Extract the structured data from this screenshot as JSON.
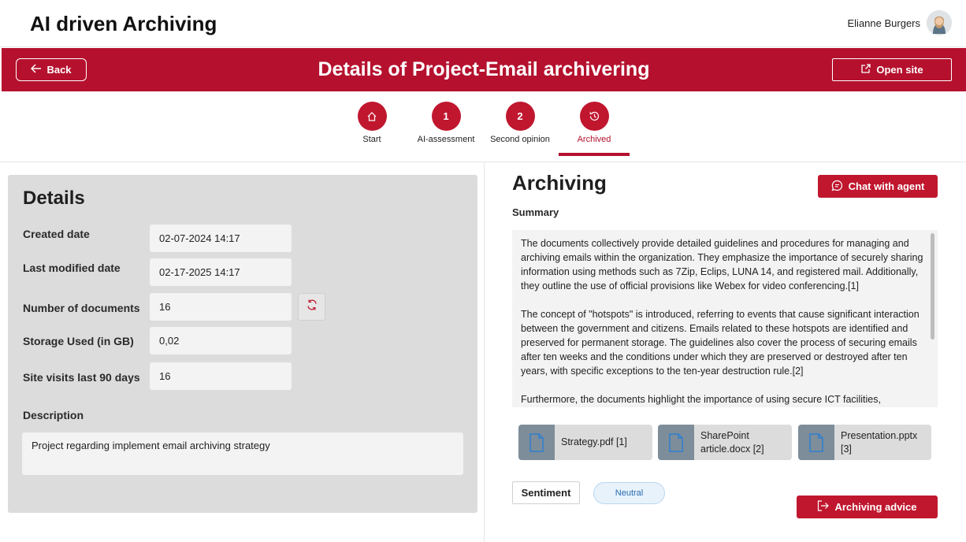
{
  "header": {
    "app_title": "AI driven Archiving",
    "user_name": "Elianne Burgers"
  },
  "banner": {
    "title": "Details of Project-Email archivering",
    "back_label": "Back",
    "open_site_label": "Open site"
  },
  "stepper": {
    "steps": [
      {
        "label": "Start",
        "badge": "",
        "icon": "home-icon"
      },
      {
        "label": "AI-assessment",
        "badge": "1"
      },
      {
        "label": "Second opinion",
        "badge": "2"
      },
      {
        "label": "Archived",
        "badge": "",
        "icon": "history-icon",
        "active": true
      }
    ]
  },
  "details": {
    "title": "Details",
    "created_label": "Created date",
    "created_value": "02-07-2024 14:17",
    "modified_label": "Last modified date",
    "modified_value": "02-17-2025 14:17",
    "docs_label": "Number of documents",
    "docs_value": "16",
    "storage_label": "Storage Used (in GB)",
    "storage_value": "0,02",
    "visits_label": "Site visits last 90 days",
    "visits_value": "16",
    "description_label": "Description",
    "description_value": "Project regarding implement email archiving strategy"
  },
  "archiving": {
    "title": "Archiving",
    "chat_label": "Chat with agent",
    "summary_label": "Summary",
    "summary_p1": "The documents collectively provide detailed guidelines and procedures for managing and archiving emails within the organization. They emphasize the importance of securely sharing information using methods such as 7Zip, Eclips, LUNA 14, and registered mail. Additionally, they outline the use of official provisions like Webex for video conferencing.[1]",
    "summary_p2": "The concept of \"hotspots\" is introduced, referring to events that cause significant interaction between the government and citizens. Emails related to these hotspots are identified and preserved for permanent storage. The guidelines also cover the process of securing emails after ten weeks and the conditions under which they are preserved or destroyed after ten years, with specific exceptions to the ten-year destruction rule.[2]",
    "summary_p3": "Furthermore, the documents highlight the importance of using secure ICT facilities,",
    "files": [
      {
        "name": "Strategy.pdf [1]"
      },
      {
        "name": "SharePoint article.docx [2]"
      },
      {
        "name": "Presentation.pptx [3]"
      }
    ],
    "sentiment_label": "Sentiment",
    "sentiment_value": "Neutral",
    "advice_label": "Archiving advice"
  },
  "colors": {
    "brand": "#b5112e",
    "accent": "#c0172f",
    "panel": "#dcdcdc",
    "file_icon_bg": "#7d8d99"
  }
}
